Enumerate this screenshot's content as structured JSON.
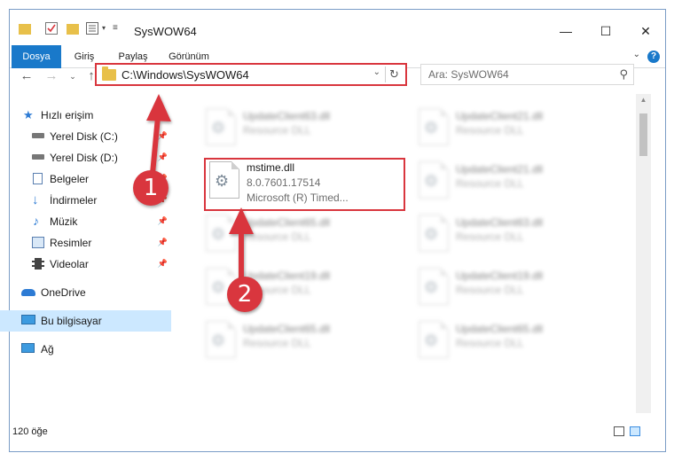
{
  "window": {
    "title": "SysWOW64"
  },
  "window_controls": {
    "minimize": "—",
    "maximize": "☐",
    "close": "✕"
  },
  "ribbon": {
    "tabs": [
      "Dosya",
      "Giriş",
      "Paylaş",
      "Görünüm"
    ],
    "help": "?"
  },
  "address": {
    "path": "C:\\Windows\\SysWOW64"
  },
  "search": {
    "placeholder": "Ara: SysWOW64"
  },
  "nav": {
    "quick_access": "Hızlı erişim",
    "items": [
      "Yerel Disk (C:)",
      "Yerel Disk (D:)",
      "Belgeler",
      "İndirmeler",
      "Müzik",
      "Resimler",
      "Videolar"
    ],
    "onedrive": "OneDrive",
    "this_pc": "Bu bilgisayar",
    "network": "Ağ"
  },
  "files": {
    "selected": {
      "name": "mstime.dll",
      "version": "8.0.7601.17514",
      "description": "Microsoft (R) Timed..."
    },
    "blurred": [
      {
        "name": "UpdateClient63.dll",
        "type": "Resource DLL"
      },
      {
        "name": "UpdateClient21.dll",
        "type": "Resource DLL"
      },
      {
        "name": "UpdateClient21.dll",
        "type": "Resource DLL"
      },
      {
        "name": "UpdateClient65.dll",
        "type": "Resource DLL"
      },
      {
        "name": "UpdateClient63.dll",
        "type": "Resource DLL"
      },
      {
        "name": "UpdateClient19.dll",
        "type": "Resource DLL"
      },
      {
        "name": "UpdateClient19.dll",
        "type": "Resource DLL"
      },
      {
        "name": "UpdateClient65.dll",
        "type": "Resource DLL"
      },
      {
        "name": "UpdateClient65.dll",
        "type": "Resource DLL"
      }
    ]
  },
  "status": {
    "count": "120 öğe"
  },
  "annotations": {
    "step1": "1",
    "step2": "2"
  },
  "colors": {
    "accent": "#1979ca",
    "highlight": "#d9363e",
    "folder": "#e8c04a",
    "selected_nav": "#cce8ff"
  }
}
